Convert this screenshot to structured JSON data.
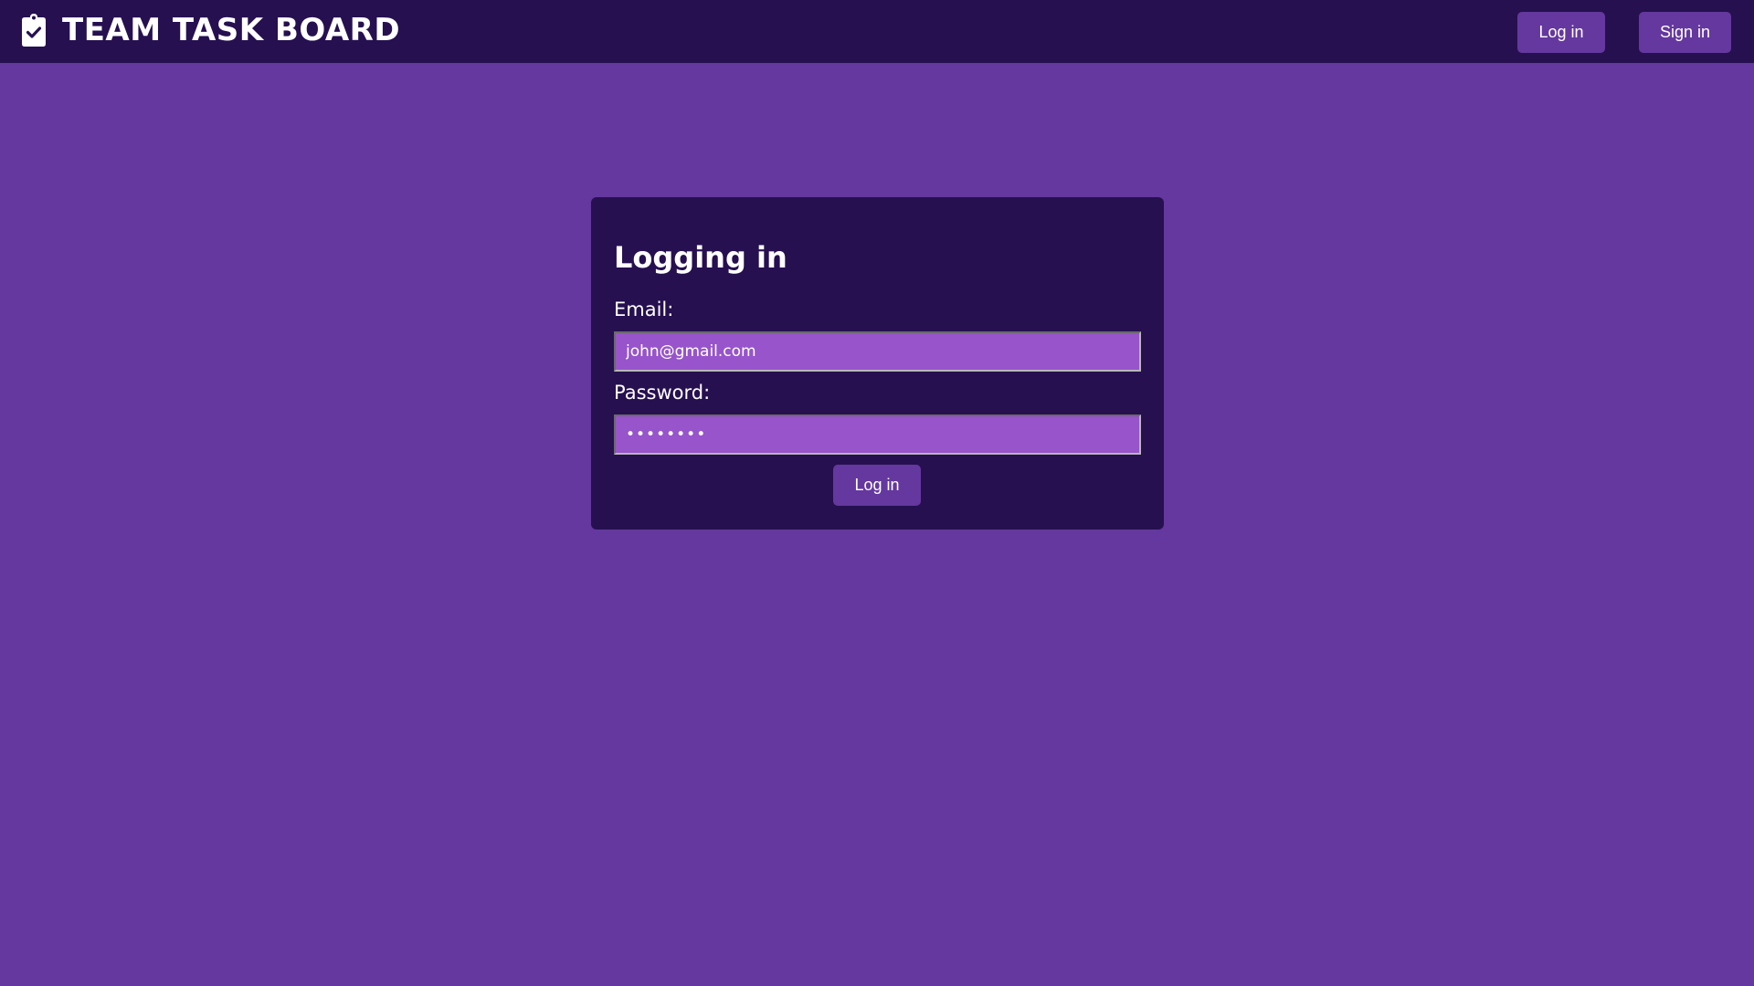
{
  "header": {
    "title": "TEAM TASK BOARD",
    "logo_icon": "clipboard-check-icon",
    "login_label": "Log in",
    "signin_label": "Sign in"
  },
  "login_form": {
    "title": "Logging in",
    "email_label": "Email:",
    "email_value": "john@gmail.com",
    "password_label": "Password:",
    "password_value": "••••••••",
    "submit_label": "Log in"
  },
  "colors": {
    "page_background": "#64389e",
    "header_background": "#261050",
    "card_background": "#261050",
    "input_background": "#9754cb",
    "button_background": "#64389e",
    "text": "#ffffff"
  }
}
